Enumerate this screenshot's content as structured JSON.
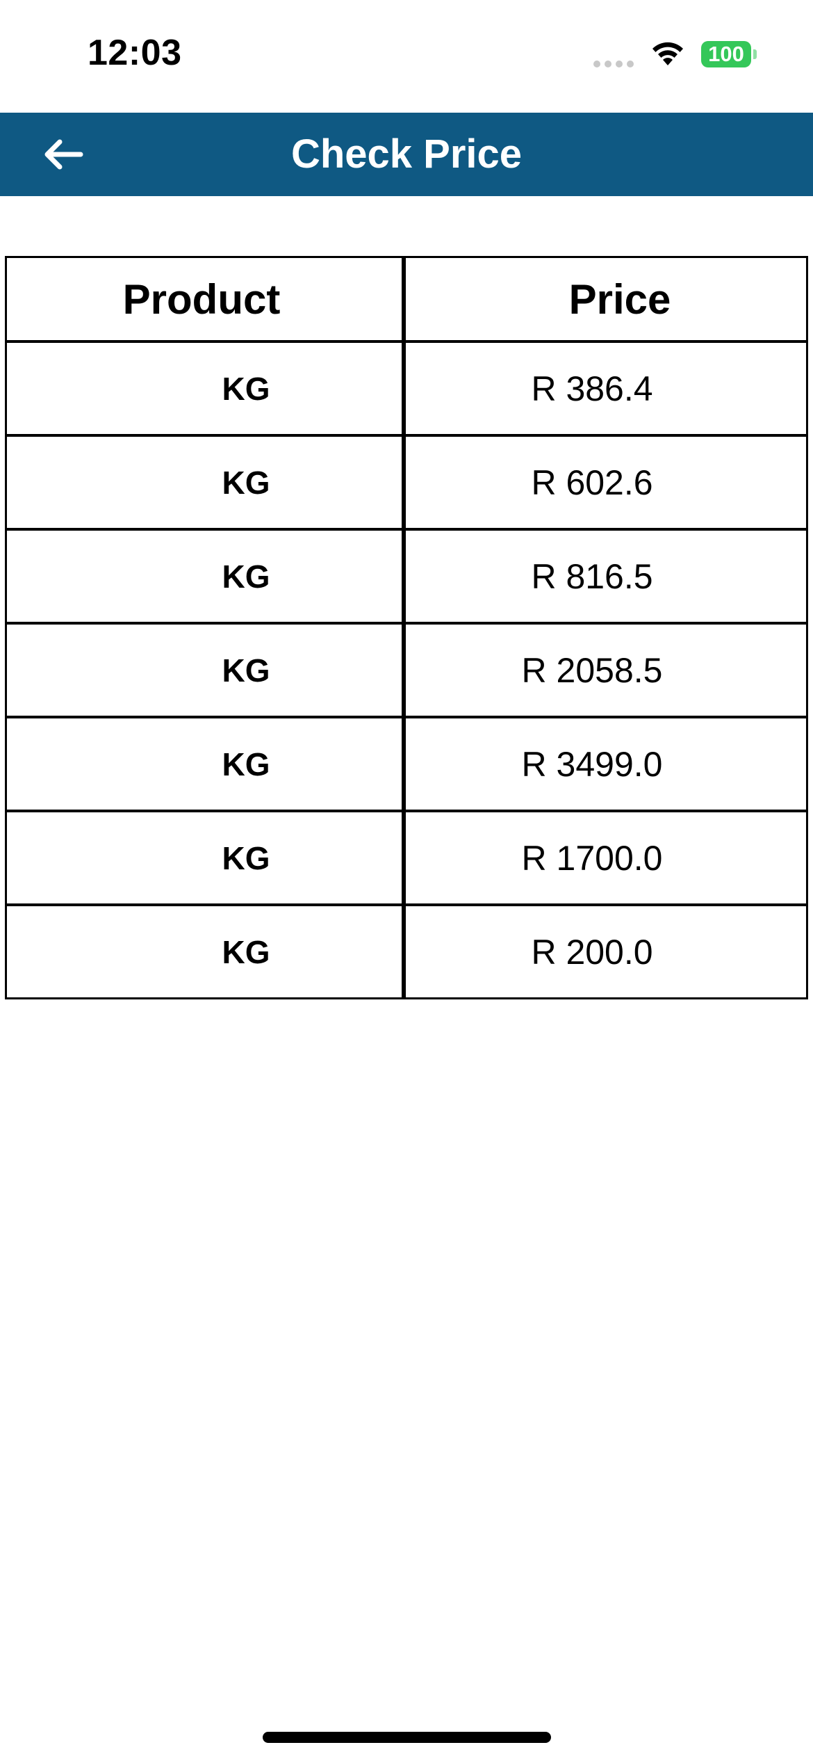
{
  "status_bar": {
    "time": "12:03",
    "battery_level": "100",
    "battery_color": "#34c759"
  },
  "header": {
    "title": "Check Price",
    "back_icon": "arrow-left-icon",
    "background_color": "#0f5983"
  },
  "table": {
    "columns": [
      "Product",
      "Price"
    ],
    "rows": [
      {
        "product": "KG",
        "price": "R 386.4"
      },
      {
        "product": "KG",
        "price": "R 602.6"
      },
      {
        "product": "KG",
        "price": "R 816.5"
      },
      {
        "product": "KG",
        "price": "R 2058.5"
      },
      {
        "product": "KG",
        "price": "R 3499.0"
      },
      {
        "product": "KG",
        "price": "R 1700.0"
      },
      {
        "product": "KG",
        "price": "R 200.0"
      }
    ]
  }
}
